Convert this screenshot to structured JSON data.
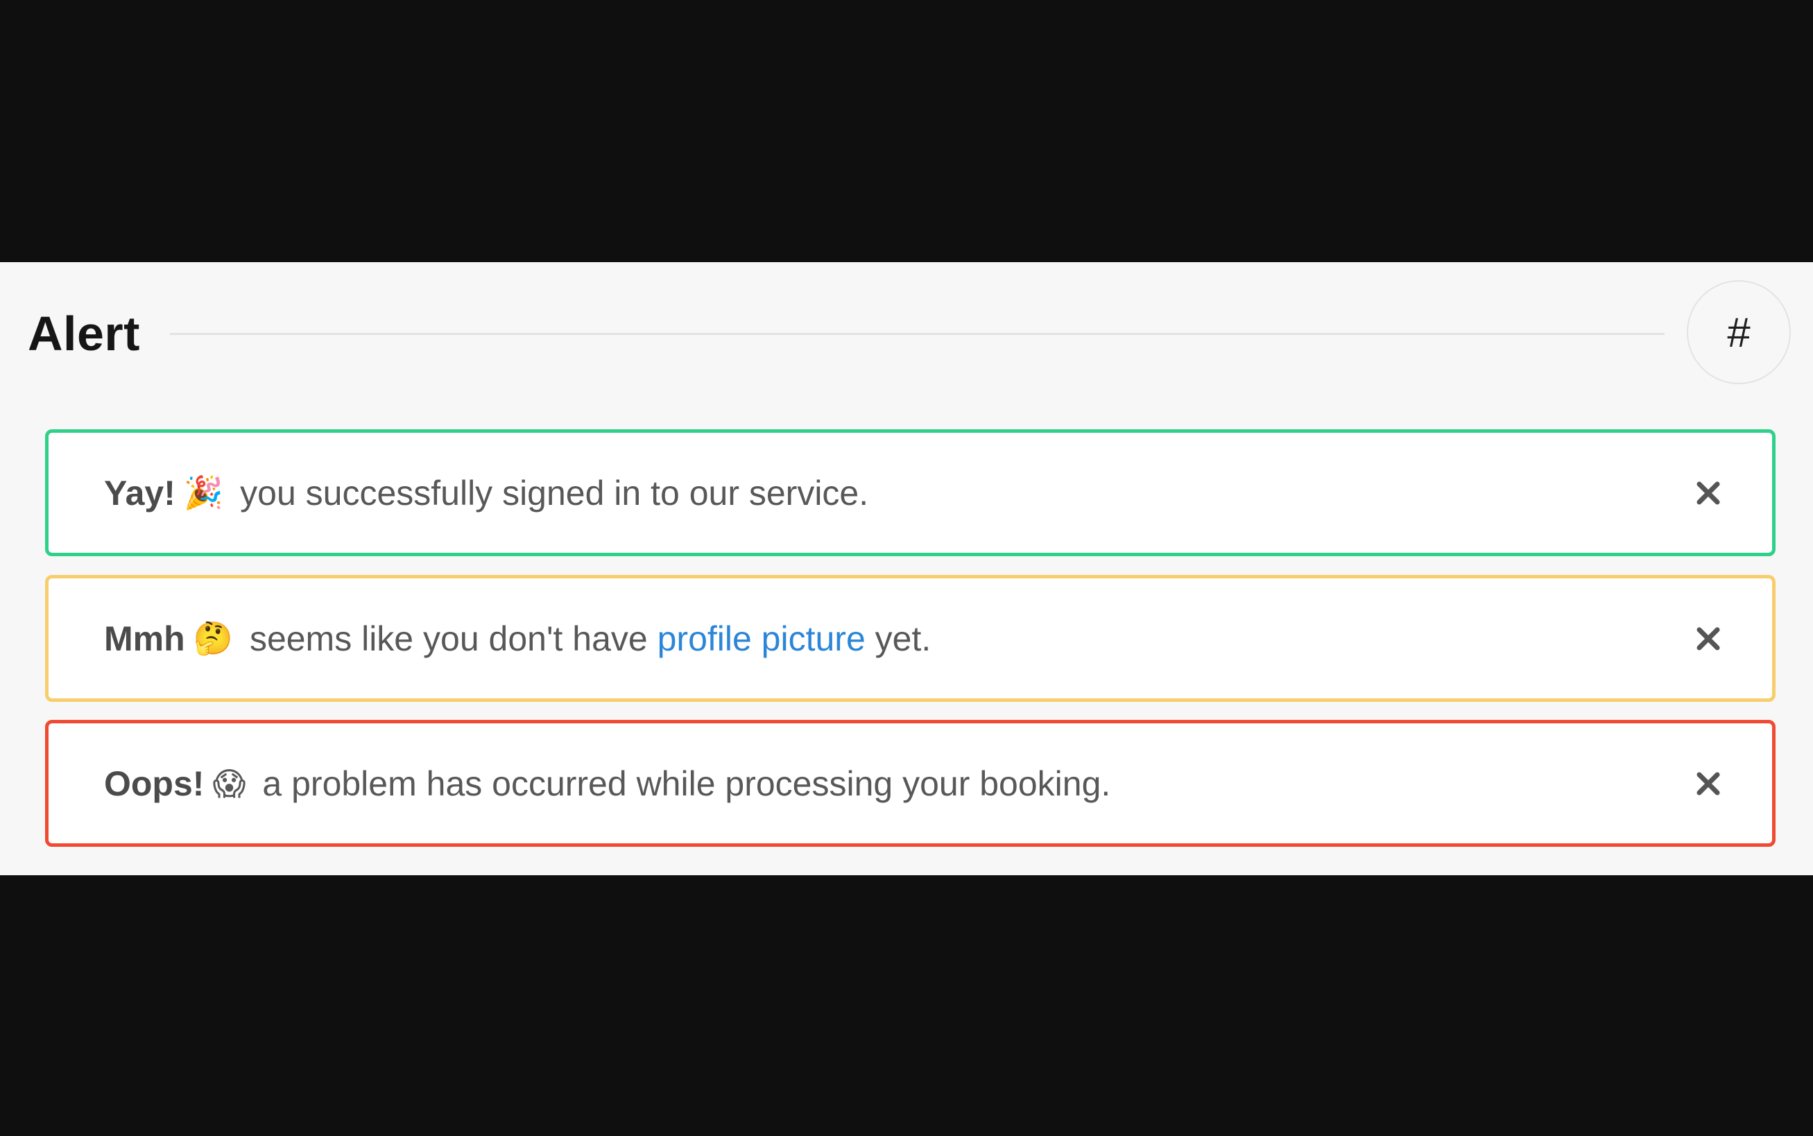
{
  "section": {
    "title": "Alert",
    "anchor_label": "#"
  },
  "alerts": [
    {
      "type": "success",
      "color": "#2fd08a",
      "strong": "Yay!",
      "emoji": "🎉",
      "message_before": "you successfully signed in to our service.",
      "close_icon": "close-icon"
    },
    {
      "type": "warning",
      "color": "#f8cd6c",
      "strong": "Mmh",
      "emoji": "🤔",
      "message_before": "seems like you don't have",
      "link": "profile picture",
      "message_after": "yet.",
      "close_icon": "close-icon"
    },
    {
      "type": "danger",
      "color": "#f04a33",
      "strong": "Oops!",
      "emoji": "😱",
      "message_before": "a problem has occurred while processing your booking.",
      "close_icon": "close-icon"
    }
  ],
  "colors": {
    "background_outer": "#0f0f0f",
    "panel": "#f7f7f7",
    "link": "#2b86d8"
  }
}
